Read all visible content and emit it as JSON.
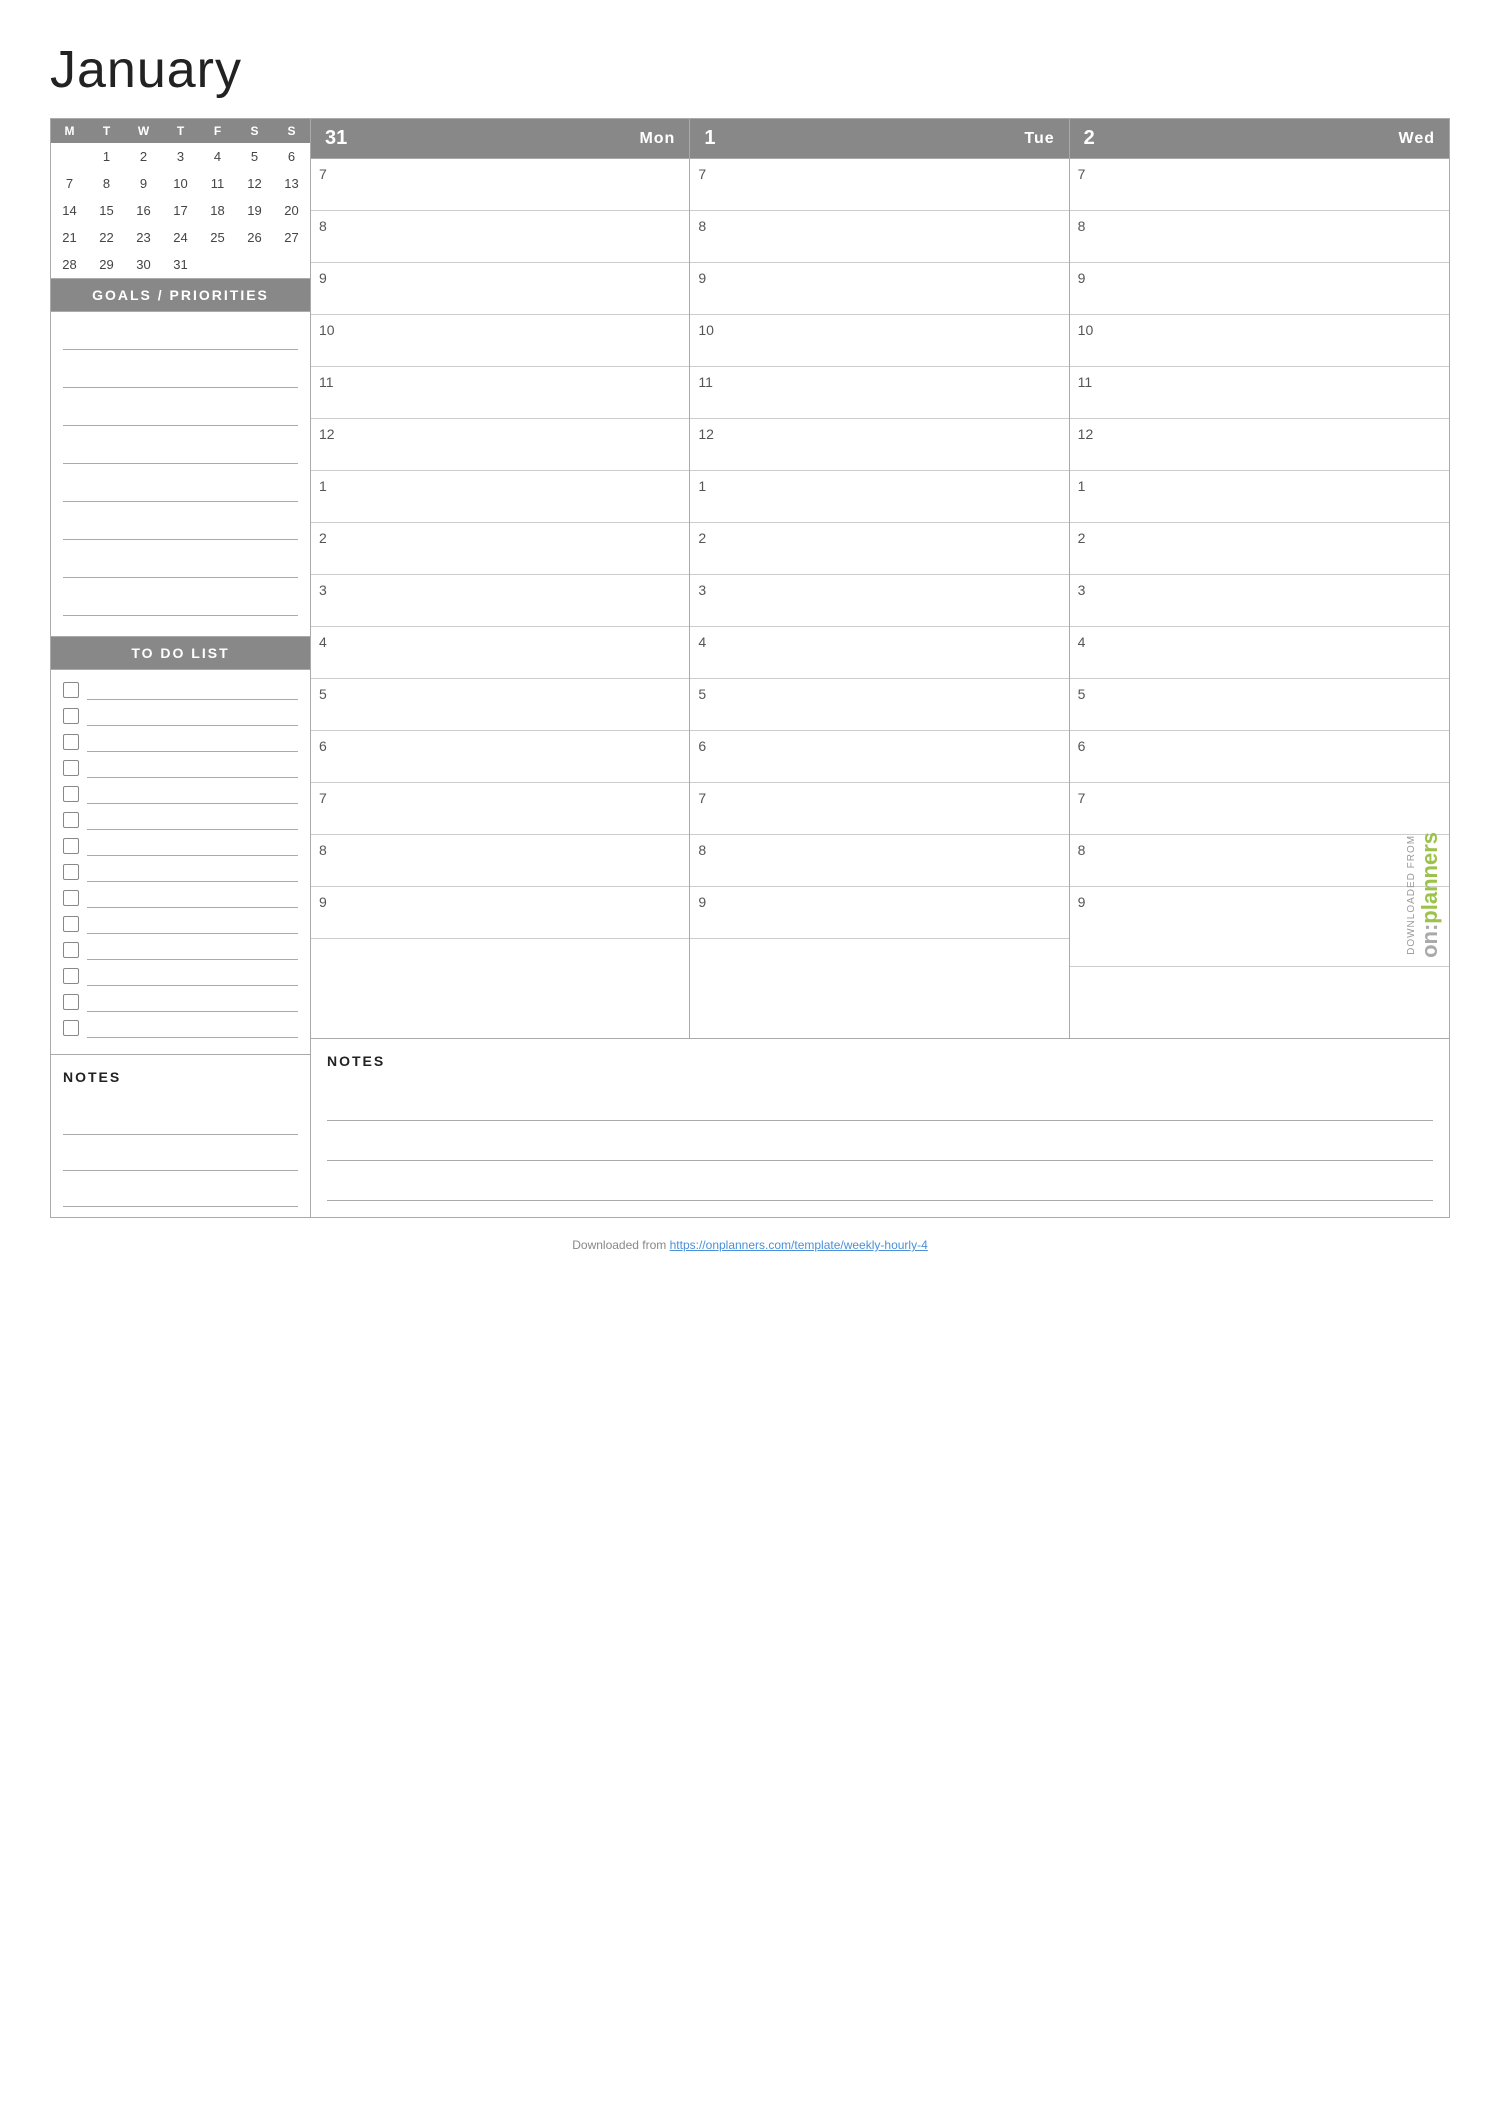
{
  "page": {
    "title": "January",
    "footer_text": "Downloaded from ",
    "footer_url": "https://onplanners.com/template/weekly-hourly-4"
  },
  "mini_calendar": {
    "headers": [
      "M",
      "T",
      "W",
      "T",
      "F",
      "S",
      "S"
    ],
    "weeks": [
      [
        "",
        "1",
        "2",
        "3",
        "4",
        "5",
        "6"
      ],
      [
        "7",
        "8",
        "9",
        "10",
        "11",
        "12",
        "13"
      ],
      [
        "14",
        "15",
        "16",
        "17",
        "18",
        "19",
        "20"
      ],
      [
        "21",
        "22",
        "23",
        "24",
        "25",
        "26",
        "27"
      ],
      [
        "28",
        "29",
        "30",
        "31",
        "",
        "",
        ""
      ]
    ]
  },
  "goals_section": {
    "label": "GOALS / PRIORITIES",
    "lines": 8
  },
  "todo_section": {
    "label": "TO DO LIST",
    "items": 14
  },
  "notes_section": {
    "label": "NOTES",
    "lines": 3
  },
  "days": [
    {
      "number": "31",
      "name": "Mon"
    },
    {
      "number": "1",
      "name": "Tue"
    },
    {
      "number": "2",
      "name": "Wed"
    }
  ],
  "hours": [
    "7",
    "",
    "8",
    "",
    "9",
    "",
    "10",
    "",
    "11",
    "",
    "12",
    "",
    "1",
    "",
    "2",
    "",
    "3",
    "",
    "4",
    "",
    "5",
    "",
    "6",
    "",
    "7",
    "",
    "8",
    "",
    "9"
  ],
  "hour_labels": [
    "7",
    "8",
    "9",
    "10",
    "11",
    "12",
    "1",
    "2",
    "3",
    "4",
    "5",
    "6",
    "7",
    "8",
    "9"
  ],
  "brand": {
    "downloaded_text": "DOWNLOADED FROM",
    "on_text": "on:",
    "planners_text": "planners"
  }
}
